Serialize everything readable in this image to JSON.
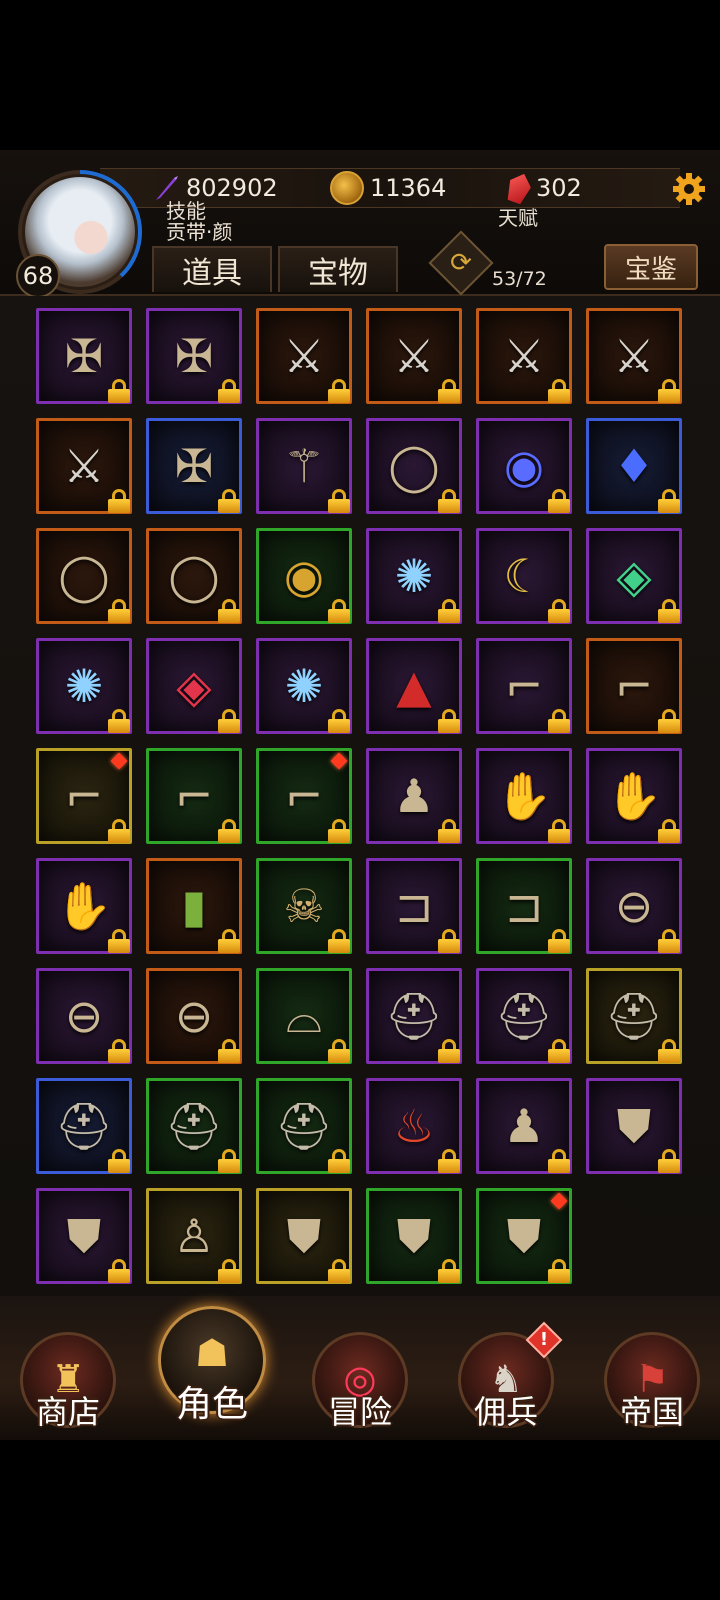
{
  "header": {
    "level": "68",
    "skill_label": "技能",
    "talent_label": "天赋",
    "name_label": "贡带·颜",
    "xp": "802902",
    "gold": "11364",
    "gems": "302"
  },
  "tabs": {
    "items": "道具",
    "treasure": "宝物"
  },
  "capacity": "53/72",
  "codex_label": "宝鉴",
  "colors": {
    "purple": "#7d2fb0",
    "orange": "#c25a18",
    "blue": "#3c5bd8",
    "green": "#2fa52a",
    "yellow": "#b9a127"
  },
  "inventory": [
    {
      "icon": "medal-icon",
      "quality": "purple"
    },
    {
      "icon": "medal-icon",
      "quality": "purple"
    },
    {
      "icon": "crossed-swords-medal-icon",
      "quality": "orange"
    },
    {
      "icon": "crossed-swords-medal-icon",
      "quality": "orange"
    },
    {
      "icon": "crossed-swords-medal-icon",
      "quality": "orange"
    },
    {
      "icon": "crossed-swords-medal-icon",
      "quality": "orange"
    },
    {
      "icon": "crossed-swords-medal-icon",
      "quality": "orange"
    },
    {
      "icon": "medal-icon",
      "quality": "blue"
    },
    {
      "icon": "staff-icon",
      "quality": "purple"
    },
    {
      "icon": "ring-icon",
      "quality": "purple"
    },
    {
      "icon": "sapphire-ring-icon",
      "quality": "purple"
    },
    {
      "icon": "amulet-icon",
      "quality": "blue"
    },
    {
      "icon": "ring-icon",
      "quality": "orange"
    },
    {
      "icon": "ring-icon",
      "quality": "orange"
    },
    {
      "icon": "gem-ring-icon",
      "quality": "green"
    },
    {
      "icon": "star-necklace-icon",
      "quality": "purple"
    },
    {
      "icon": "moon-necklace-icon",
      "quality": "purple"
    },
    {
      "icon": "emerald-necklace-icon",
      "quality": "purple"
    },
    {
      "icon": "star-necklace-icon",
      "quality": "purple"
    },
    {
      "icon": "ruby-necklace-icon",
      "quality": "purple"
    },
    {
      "icon": "star-necklace-icon",
      "quality": "purple"
    },
    {
      "icon": "cloak-icon",
      "quality": "purple"
    },
    {
      "icon": "boots-icon",
      "quality": "purple"
    },
    {
      "icon": "boots-icon",
      "quality": "orange"
    },
    {
      "icon": "boots-icon",
      "quality": "yellow",
      "is_new": true
    },
    {
      "icon": "boots-icon",
      "quality": "green"
    },
    {
      "icon": "boots-icon",
      "quality": "green",
      "is_new": true
    },
    {
      "icon": "robe-icon",
      "quality": "purple"
    },
    {
      "icon": "gauntlet-icon",
      "quality": "purple"
    },
    {
      "icon": "gauntlet-icon",
      "quality": "purple"
    },
    {
      "icon": "glove-icon",
      "quality": "purple"
    },
    {
      "icon": "shield-icon",
      "quality": "orange"
    },
    {
      "icon": "mask-icon",
      "quality": "green"
    },
    {
      "icon": "bracer-icon",
      "quality": "purple"
    },
    {
      "icon": "bracer-icon",
      "quality": "green"
    },
    {
      "icon": "belt-icon",
      "quality": "purple"
    },
    {
      "icon": "belt-icon",
      "quality": "purple"
    },
    {
      "icon": "belt-icon",
      "quality": "orange"
    },
    {
      "icon": "pauldron-icon",
      "quality": "green"
    },
    {
      "icon": "helmet-icon",
      "quality": "purple"
    },
    {
      "icon": "helmet-icon",
      "quality": "purple"
    },
    {
      "icon": "helmet-icon",
      "quality": "yellow"
    },
    {
      "icon": "helmet-icon",
      "quality": "blue"
    },
    {
      "icon": "helmet-icon",
      "quality": "green"
    },
    {
      "icon": "helmet-icon",
      "quality": "green"
    },
    {
      "icon": "fire-robe-icon",
      "quality": "purple"
    },
    {
      "icon": "robe-icon",
      "quality": "purple"
    },
    {
      "icon": "armor-icon",
      "quality": "purple"
    },
    {
      "icon": "armor-icon",
      "quality": "purple"
    },
    {
      "icon": "tunic-icon",
      "quality": "yellow"
    },
    {
      "icon": "armor-icon",
      "quality": "yellow"
    },
    {
      "icon": "armor-icon",
      "quality": "green"
    },
    {
      "icon": "armor-icon",
      "quality": "green",
      "is_new": true
    }
  ],
  "nav": {
    "shop": "商店",
    "role": "角色",
    "adventure": "冒险",
    "mercenary": "佣兵",
    "mercenary_alert": "!",
    "empire": "帝国"
  }
}
